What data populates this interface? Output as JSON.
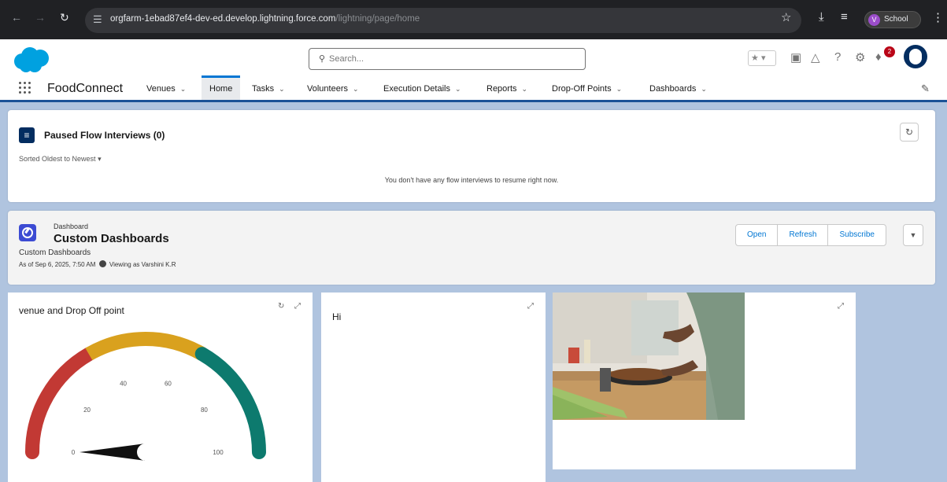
{
  "browser": {
    "url_host": "orgfarm-1ebad87ef4-dev-ed.develop.lightning.force.com",
    "url_path": "/lightning/page/home",
    "profile_initial": "V",
    "profile_label": "School"
  },
  "header": {
    "search_placeholder": "Search...",
    "notification_count": "2"
  },
  "nav": {
    "app_name": "FoodConnect",
    "tabs": [
      {
        "label": "Venues",
        "has_menu": true
      },
      {
        "label": "Home",
        "active": true
      },
      {
        "label": "Tasks",
        "has_menu": true
      },
      {
        "label": "Volunteers",
        "has_menu": true
      },
      {
        "label": "Execution Details",
        "has_menu": true
      },
      {
        "label": "Reports",
        "has_menu": true
      },
      {
        "label": "Drop-Off Points",
        "has_menu": true
      },
      {
        "label": "Dashboards",
        "has_menu": true
      }
    ]
  },
  "flow_card": {
    "title": "Paused Flow Interviews (0)",
    "sort_label": "Sorted Oldest to Newest",
    "empty_message": "You don't have any flow interviews to resume right now."
  },
  "dashboard_card": {
    "label": "Dashboard",
    "title": "Custom Dashboards",
    "subtitle": "Custom Dashboards",
    "as_of": "As of Sep 6, 2025, 7:50 AM",
    "viewing_as": "Viewing as Varshini K.R",
    "buttons": [
      "Open",
      "Refresh",
      "Subscribe"
    ]
  },
  "widgets": {
    "gauge_title": "venue and Drop Off point",
    "text_widget": "Hi"
  },
  "chart_data": {
    "type": "gauge",
    "title": "venue and Drop Off point",
    "min": 0,
    "max": 100,
    "value": 0,
    "tick_labels": [
      "0",
      "20",
      "40",
      "60",
      "80",
      "100"
    ],
    "bands": [
      {
        "from": 0,
        "to": 33.3,
        "color": "#c23934"
      },
      {
        "from": 33.3,
        "to": 66.6,
        "color": "#d9a11e"
      },
      {
        "from": 66.6,
        "to": 100,
        "color": "#0d7a6e"
      }
    ]
  },
  "colors": {
    "brand_blue": "#0176d3",
    "nav_border": "#1b5297",
    "page_bg": "#b0c4df"
  }
}
